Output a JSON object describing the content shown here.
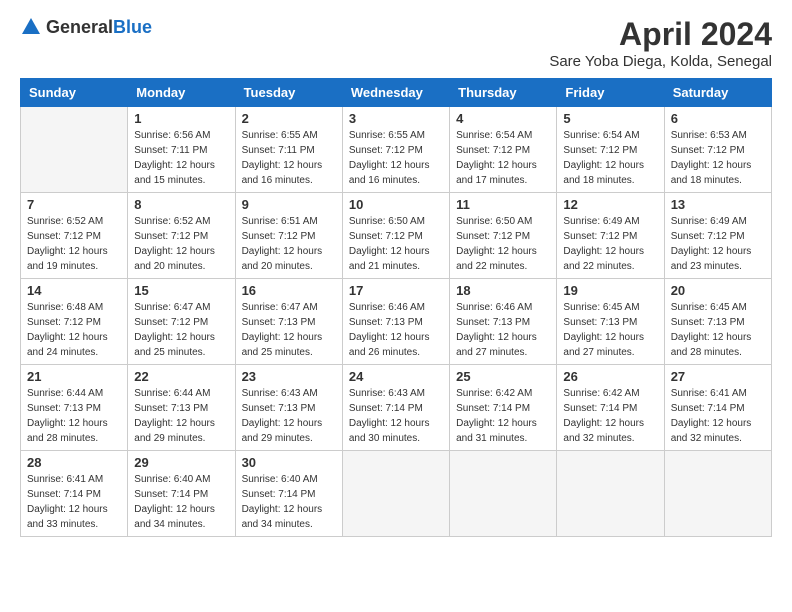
{
  "header": {
    "logo_general": "General",
    "logo_blue": "Blue",
    "title": "April 2024",
    "subtitle": "Sare Yoba Diega, Kolda, Senegal"
  },
  "calendar": {
    "days_of_week": [
      "Sunday",
      "Monday",
      "Tuesday",
      "Wednesday",
      "Thursday",
      "Friday",
      "Saturday"
    ],
    "weeks": [
      [
        {
          "day": "",
          "sunrise": "",
          "sunset": "",
          "daylight": ""
        },
        {
          "day": "1",
          "sunrise": "Sunrise: 6:56 AM",
          "sunset": "Sunset: 7:11 PM",
          "daylight": "Daylight: 12 hours and 15 minutes."
        },
        {
          "day": "2",
          "sunrise": "Sunrise: 6:55 AM",
          "sunset": "Sunset: 7:11 PM",
          "daylight": "Daylight: 12 hours and 16 minutes."
        },
        {
          "day": "3",
          "sunrise": "Sunrise: 6:55 AM",
          "sunset": "Sunset: 7:12 PM",
          "daylight": "Daylight: 12 hours and 16 minutes."
        },
        {
          "day": "4",
          "sunrise": "Sunrise: 6:54 AM",
          "sunset": "Sunset: 7:12 PM",
          "daylight": "Daylight: 12 hours and 17 minutes."
        },
        {
          "day": "5",
          "sunrise": "Sunrise: 6:54 AM",
          "sunset": "Sunset: 7:12 PM",
          "daylight": "Daylight: 12 hours and 18 minutes."
        },
        {
          "day": "6",
          "sunrise": "Sunrise: 6:53 AM",
          "sunset": "Sunset: 7:12 PM",
          "daylight": "Daylight: 12 hours and 18 minutes."
        }
      ],
      [
        {
          "day": "7",
          "sunrise": "Sunrise: 6:52 AM",
          "sunset": "Sunset: 7:12 PM",
          "daylight": "Daylight: 12 hours and 19 minutes."
        },
        {
          "day": "8",
          "sunrise": "Sunrise: 6:52 AM",
          "sunset": "Sunset: 7:12 PM",
          "daylight": "Daylight: 12 hours and 20 minutes."
        },
        {
          "day": "9",
          "sunrise": "Sunrise: 6:51 AM",
          "sunset": "Sunset: 7:12 PM",
          "daylight": "Daylight: 12 hours and 20 minutes."
        },
        {
          "day": "10",
          "sunrise": "Sunrise: 6:50 AM",
          "sunset": "Sunset: 7:12 PM",
          "daylight": "Daylight: 12 hours and 21 minutes."
        },
        {
          "day": "11",
          "sunrise": "Sunrise: 6:50 AM",
          "sunset": "Sunset: 7:12 PM",
          "daylight": "Daylight: 12 hours and 22 minutes."
        },
        {
          "day": "12",
          "sunrise": "Sunrise: 6:49 AM",
          "sunset": "Sunset: 7:12 PM",
          "daylight": "Daylight: 12 hours and 22 minutes."
        },
        {
          "day": "13",
          "sunrise": "Sunrise: 6:49 AM",
          "sunset": "Sunset: 7:12 PM",
          "daylight": "Daylight: 12 hours and 23 minutes."
        }
      ],
      [
        {
          "day": "14",
          "sunrise": "Sunrise: 6:48 AM",
          "sunset": "Sunset: 7:12 PM",
          "daylight": "Daylight: 12 hours and 24 minutes."
        },
        {
          "day": "15",
          "sunrise": "Sunrise: 6:47 AM",
          "sunset": "Sunset: 7:12 PM",
          "daylight": "Daylight: 12 hours and 25 minutes."
        },
        {
          "day": "16",
          "sunrise": "Sunrise: 6:47 AM",
          "sunset": "Sunset: 7:13 PM",
          "daylight": "Daylight: 12 hours and 25 minutes."
        },
        {
          "day": "17",
          "sunrise": "Sunrise: 6:46 AM",
          "sunset": "Sunset: 7:13 PM",
          "daylight": "Daylight: 12 hours and 26 minutes."
        },
        {
          "day": "18",
          "sunrise": "Sunrise: 6:46 AM",
          "sunset": "Sunset: 7:13 PM",
          "daylight": "Daylight: 12 hours and 27 minutes."
        },
        {
          "day": "19",
          "sunrise": "Sunrise: 6:45 AM",
          "sunset": "Sunset: 7:13 PM",
          "daylight": "Daylight: 12 hours and 27 minutes."
        },
        {
          "day": "20",
          "sunrise": "Sunrise: 6:45 AM",
          "sunset": "Sunset: 7:13 PM",
          "daylight": "Daylight: 12 hours and 28 minutes."
        }
      ],
      [
        {
          "day": "21",
          "sunrise": "Sunrise: 6:44 AM",
          "sunset": "Sunset: 7:13 PM",
          "daylight": "Daylight: 12 hours and 28 minutes."
        },
        {
          "day": "22",
          "sunrise": "Sunrise: 6:44 AM",
          "sunset": "Sunset: 7:13 PM",
          "daylight": "Daylight: 12 hours and 29 minutes."
        },
        {
          "day": "23",
          "sunrise": "Sunrise: 6:43 AM",
          "sunset": "Sunset: 7:13 PM",
          "daylight": "Daylight: 12 hours and 29 minutes."
        },
        {
          "day": "24",
          "sunrise": "Sunrise: 6:43 AM",
          "sunset": "Sunset: 7:14 PM",
          "daylight": "Daylight: 12 hours and 30 minutes."
        },
        {
          "day": "25",
          "sunrise": "Sunrise: 6:42 AM",
          "sunset": "Sunset: 7:14 PM",
          "daylight": "Daylight: 12 hours and 31 minutes."
        },
        {
          "day": "26",
          "sunrise": "Sunrise: 6:42 AM",
          "sunset": "Sunset: 7:14 PM",
          "daylight": "Daylight: 12 hours and 32 minutes."
        },
        {
          "day": "27",
          "sunrise": "Sunrise: 6:41 AM",
          "sunset": "Sunset: 7:14 PM",
          "daylight": "Daylight: 12 hours and 32 minutes."
        }
      ],
      [
        {
          "day": "28",
          "sunrise": "Sunrise: 6:41 AM",
          "sunset": "Sunset: 7:14 PM",
          "daylight": "Daylight: 12 hours and 33 minutes."
        },
        {
          "day": "29",
          "sunrise": "Sunrise: 6:40 AM",
          "sunset": "Sunset: 7:14 PM",
          "daylight": "Daylight: 12 hours and 34 minutes."
        },
        {
          "day": "30",
          "sunrise": "Sunrise: 6:40 AM",
          "sunset": "Sunset: 7:14 PM",
          "daylight": "Daylight: 12 hours and 34 minutes."
        },
        {
          "day": "",
          "sunrise": "",
          "sunset": "",
          "daylight": ""
        },
        {
          "day": "",
          "sunrise": "",
          "sunset": "",
          "daylight": ""
        },
        {
          "day": "",
          "sunrise": "",
          "sunset": "",
          "daylight": ""
        },
        {
          "day": "",
          "sunrise": "",
          "sunset": "",
          "daylight": ""
        }
      ]
    ]
  }
}
